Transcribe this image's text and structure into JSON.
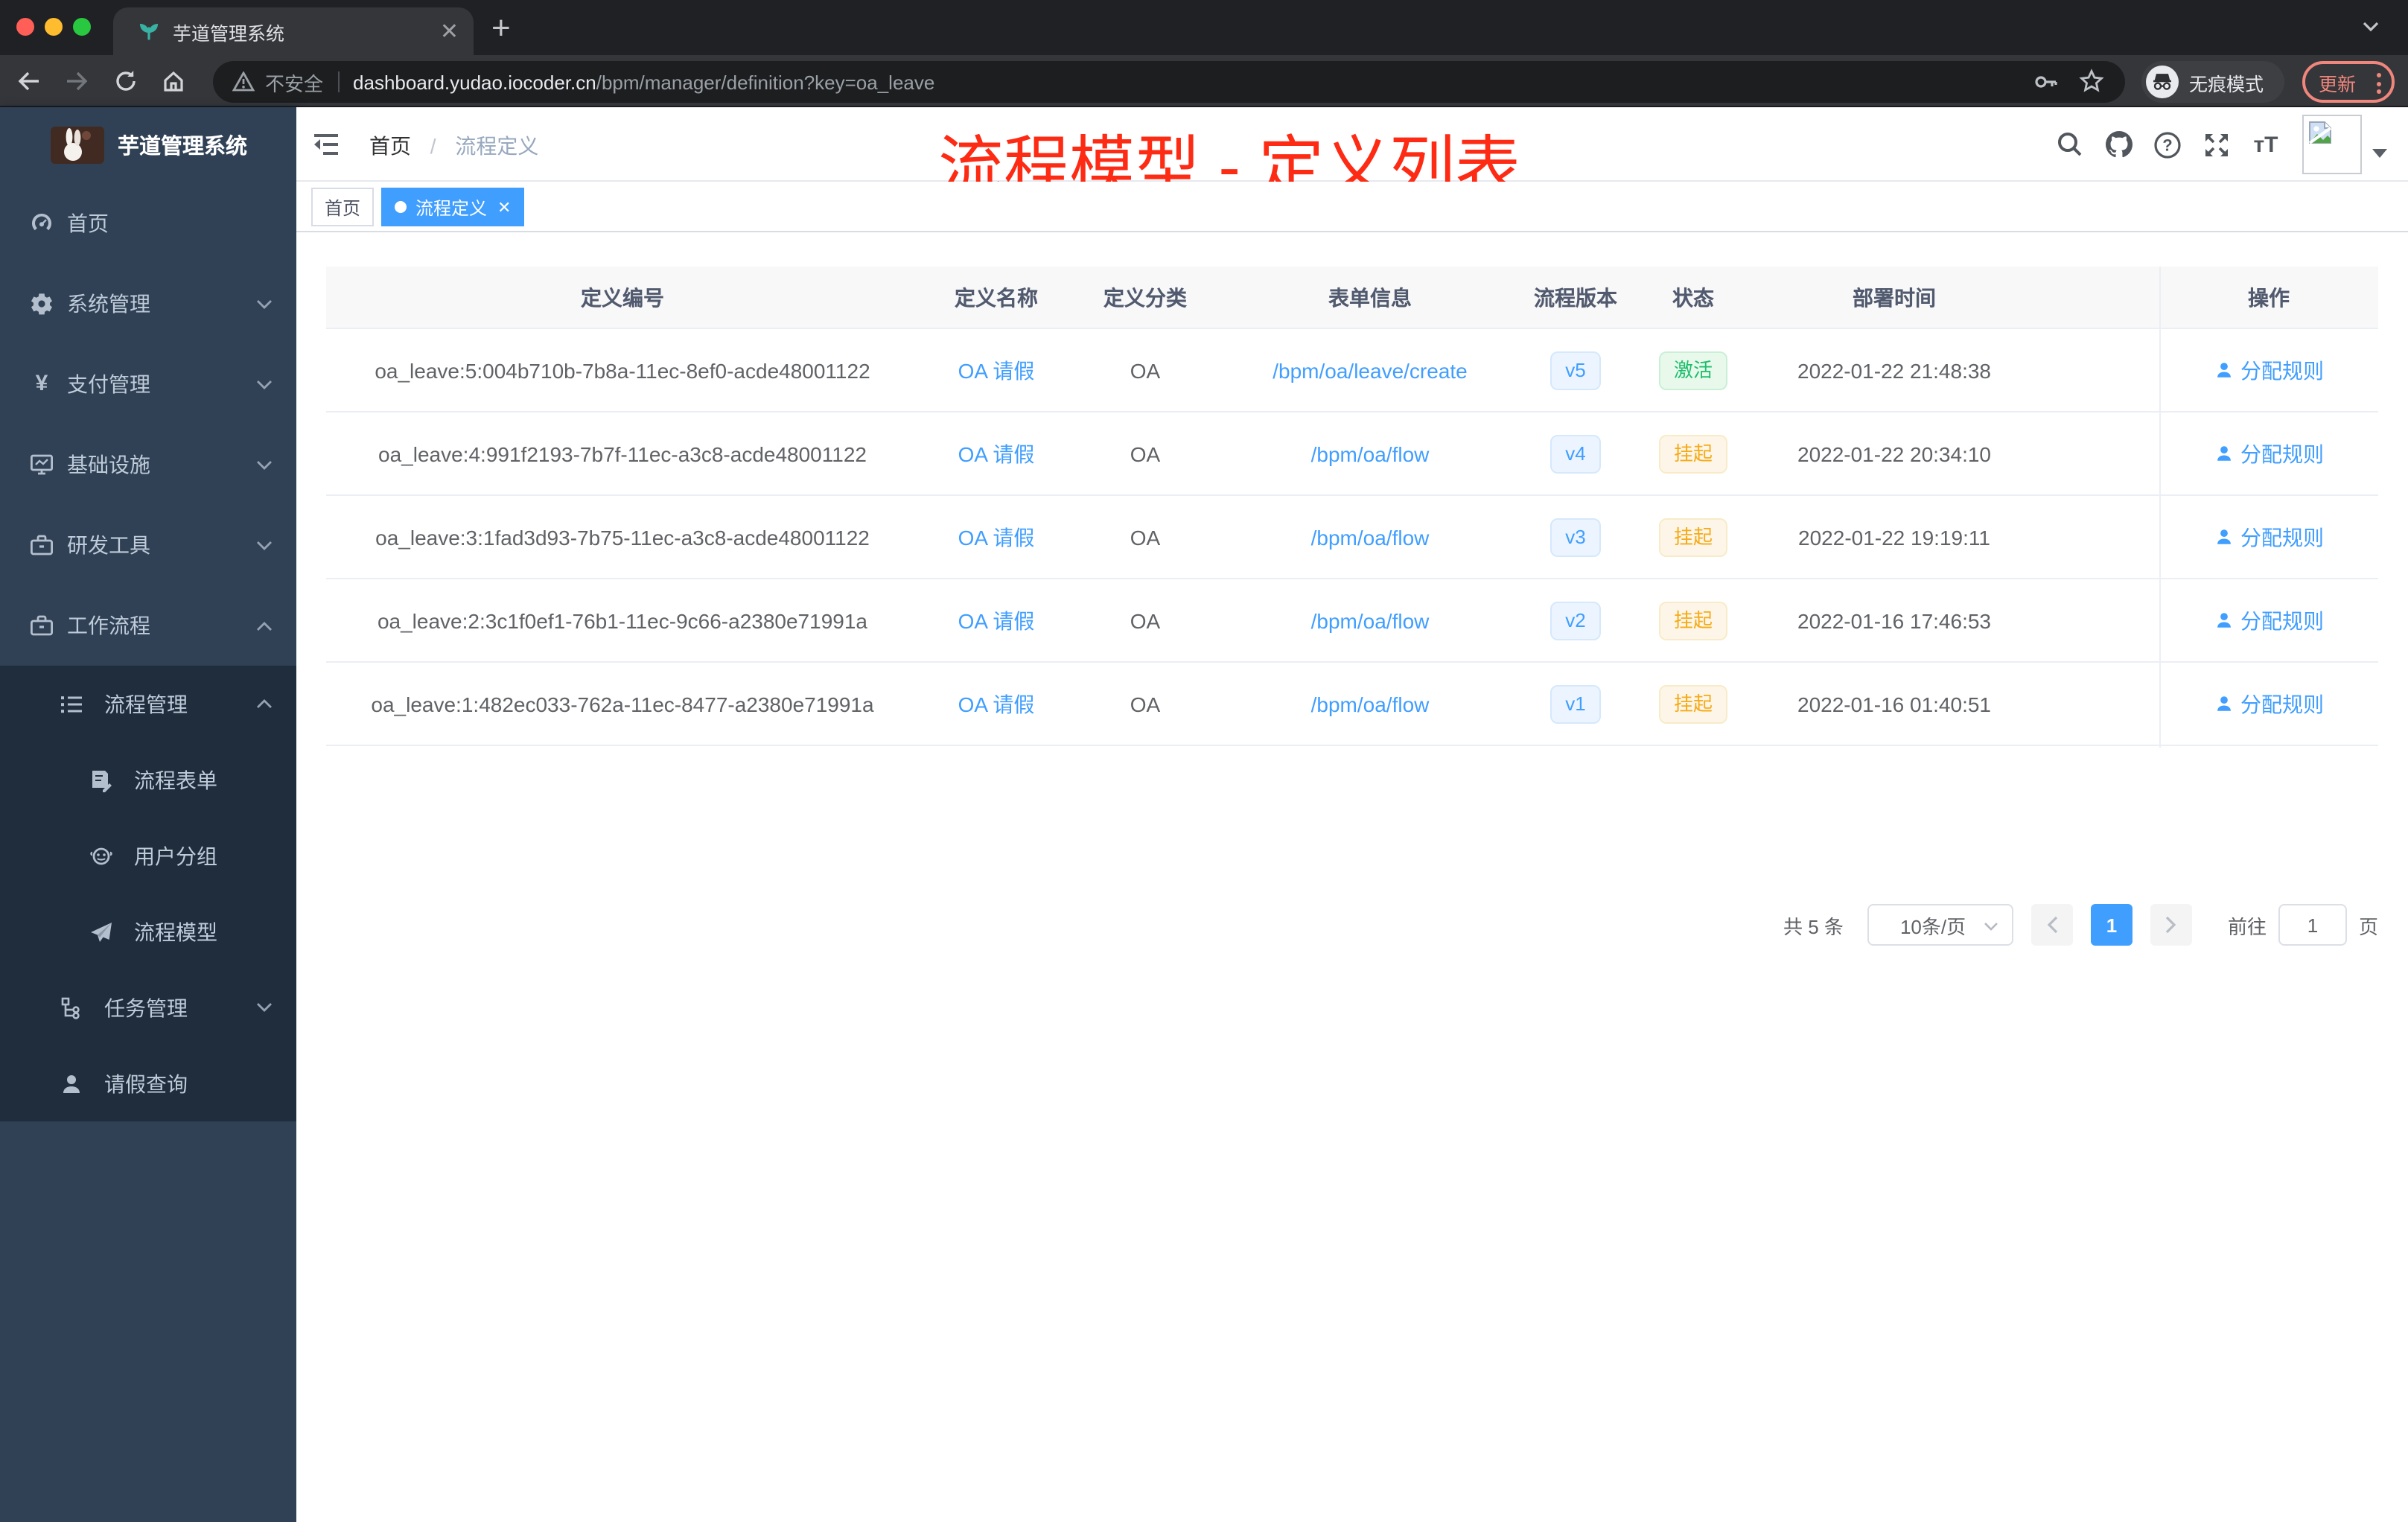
{
  "browser": {
    "tab_title": "芋道管理系统",
    "security_label": "不安全",
    "url_domain": "dashboard.yudao.iocoder.cn",
    "url_path": "/bpm/manager/definition?key=oa_leave",
    "incognito_label": "无痕模式",
    "update_label": "更新"
  },
  "sidebar": {
    "logo_title": "芋道管理系统",
    "items": [
      {
        "label": "首页"
      },
      {
        "label": "系统管理"
      },
      {
        "label": "支付管理"
      },
      {
        "label": "基础设施"
      },
      {
        "label": "研发工具"
      },
      {
        "label": "工作流程"
      }
    ],
    "submenu": {
      "label": "流程管理",
      "children": [
        {
          "label": "流程表单"
        },
        {
          "label": "用户分组"
        },
        {
          "label": "流程模型"
        }
      ]
    },
    "task_item": {
      "label": "任务管理"
    },
    "leave_item": {
      "label": "请假查询"
    }
  },
  "navbar": {
    "breadcrumb_home": "首页",
    "breadcrumb_current": "流程定义"
  },
  "annotation": {
    "text": "流程模型 - 定义列表",
    "color": "#fe2b14"
  },
  "tags": [
    {
      "label": "首页",
      "active": false
    },
    {
      "label": "流程定义",
      "active": true
    }
  ],
  "table": {
    "columns": [
      "定义编号",
      "定义名称",
      "定义分类",
      "表单信息",
      "流程版本",
      "状态",
      "部署时间",
      "操作"
    ],
    "rows": [
      {
        "id": "oa_leave:5:004b710b-7b8a-11ec-8ef0-acde48001122",
        "name": "OA 请假",
        "category": "OA",
        "form": "/bpm/oa/leave/create",
        "version": "v5",
        "status": "激活",
        "status_type": "active",
        "time": "2022-01-22 21:48:38",
        "action": "分配规则"
      },
      {
        "id": "oa_leave:4:991f2193-7b7f-11ec-a3c8-acde48001122",
        "name": "OA 请假",
        "category": "OA",
        "form": "/bpm/oa/flow",
        "version": "v4",
        "status": "挂起",
        "status_type": "suspend",
        "time": "2022-01-22 20:34:10",
        "action": "分配规则"
      },
      {
        "id": "oa_leave:3:1fad3d93-7b75-11ec-a3c8-acde48001122",
        "name": "OA 请假",
        "category": "OA",
        "form": "/bpm/oa/flow",
        "version": "v3",
        "status": "挂起",
        "status_type": "suspend",
        "time": "2022-01-22 19:19:11",
        "action": "分配规则"
      },
      {
        "id": "oa_leave:2:3c1f0ef1-76b1-11ec-9c66-a2380e71991a",
        "name": "OA 请假",
        "category": "OA",
        "form": "/bpm/oa/flow",
        "version": "v2",
        "status": "挂起",
        "status_type": "suspend",
        "time": "2022-01-16 17:46:53",
        "action": "分配规则"
      },
      {
        "id": "oa_leave:1:482ec033-762a-11ec-8477-a2380e71991a",
        "name": "OA 请假",
        "category": "OA",
        "form": "/bpm/oa/flow",
        "version": "v1",
        "status": "挂起",
        "status_type": "suspend",
        "time": "2022-01-16 01:40:51",
        "action": "分配规则"
      }
    ]
  },
  "pagination": {
    "total": "共 5 条",
    "page_size": "10条/页",
    "current_page": "1",
    "goto_label": "前往",
    "goto_value": "1",
    "page_suffix": "页"
  },
  "colors": {
    "accent": "#409eff",
    "sidebar_bg": "#304156",
    "submenu_bg": "#1f2d3d",
    "active_green": "#1cbe6b",
    "suspend_yellow": "#f5ab18",
    "annotation_red": "#fe2b14"
  }
}
